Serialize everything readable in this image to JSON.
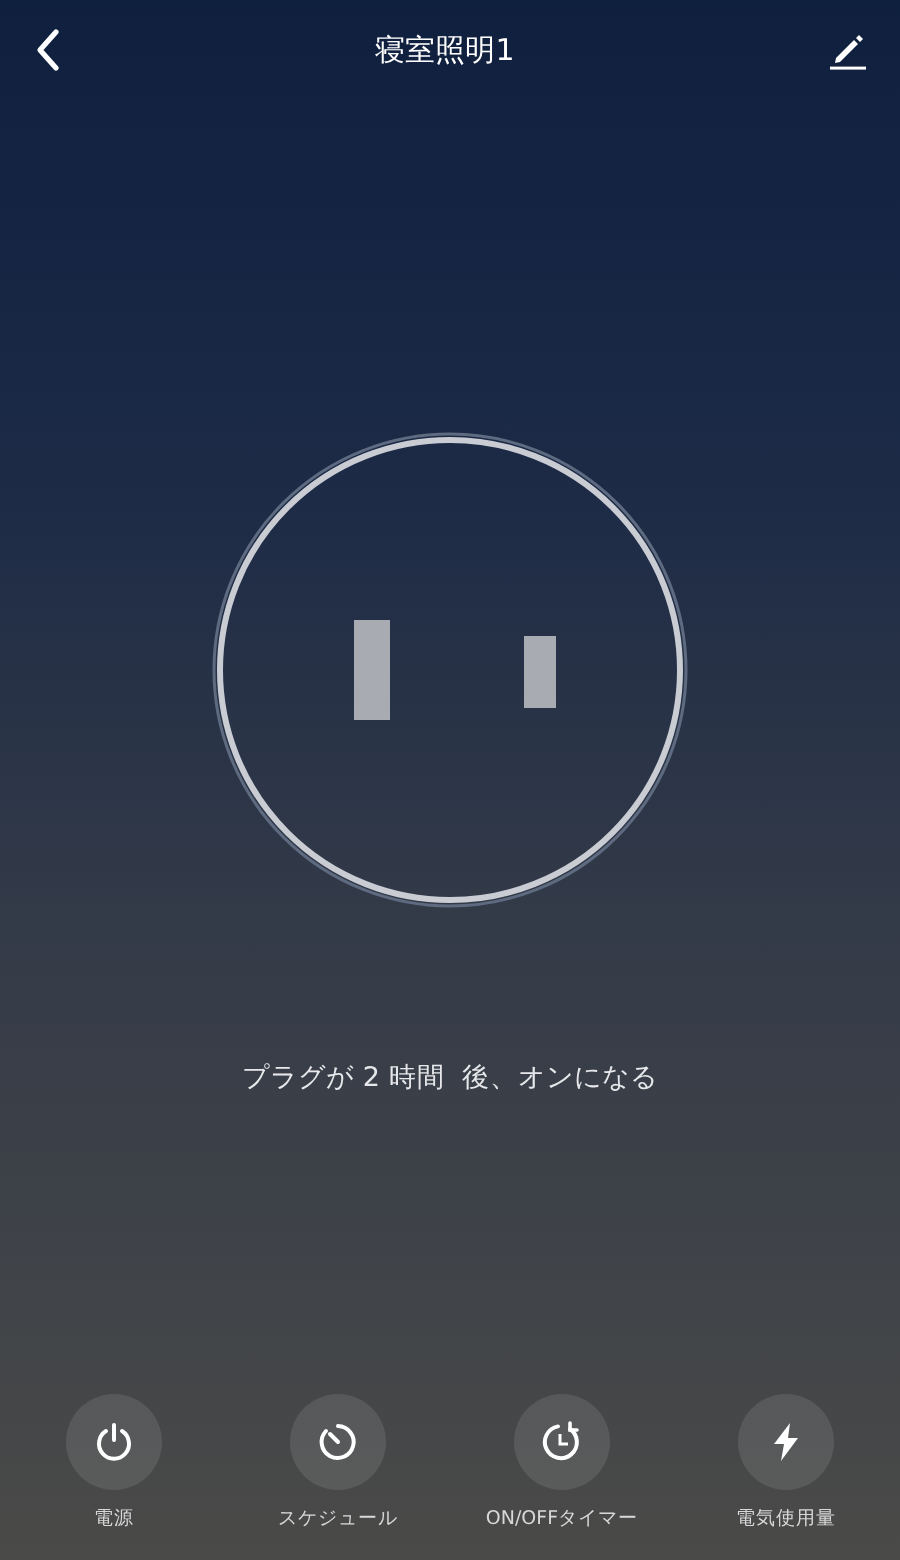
{
  "header": {
    "title": "寝室照明1"
  },
  "status": {
    "text": "プラグが 2 時間  後、オンになる"
  },
  "actions": [
    {
      "kind": "power",
      "label": "電源"
    },
    {
      "kind": "schedule",
      "label": "スケジュール"
    },
    {
      "kind": "timer",
      "label": "ON/OFFタイマー"
    },
    {
      "kind": "energy",
      "label": "電気使用量"
    }
  ]
}
